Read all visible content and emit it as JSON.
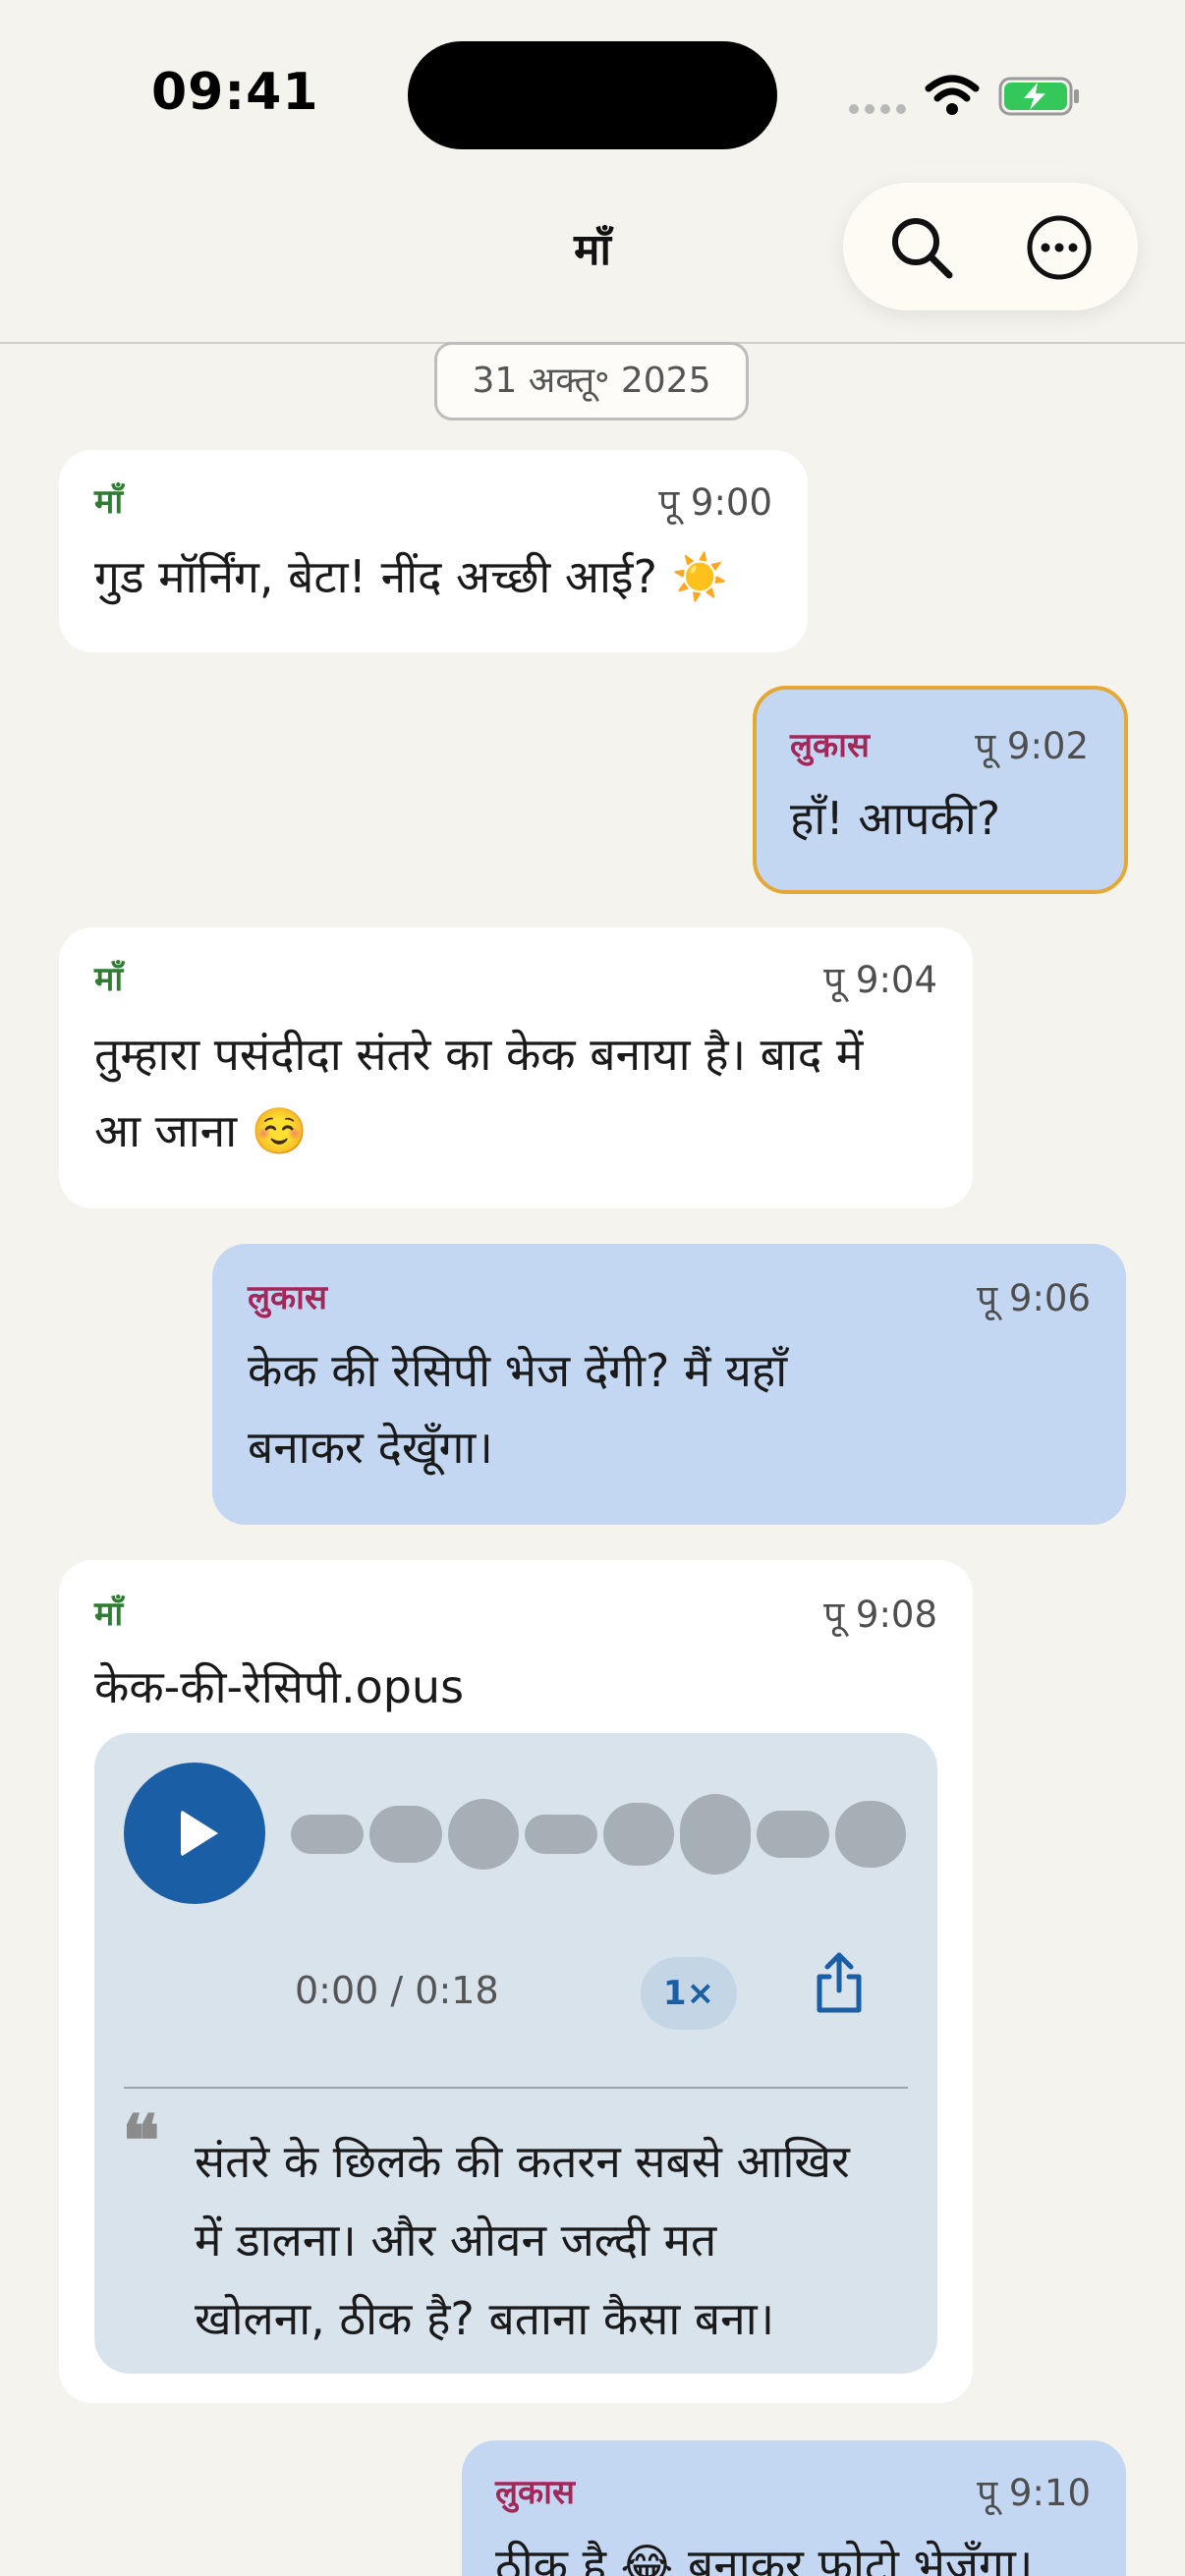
{
  "status_bar": {
    "time": "09:41",
    "icons": [
      "signal-dots-icon",
      "wifi-icon",
      "battery-charging-icon"
    ],
    "battery_color": "#34c759"
  },
  "header": {
    "title": "माँ",
    "actions": [
      "search-icon",
      "more-icon"
    ]
  },
  "date_chip": "31 अक्तू॰ 2025",
  "messages": [
    {
      "direction": "in",
      "sender": "माँ",
      "time": "पू 9:00",
      "text": "गुड मॉर्निंग, बेटा! नींद अच्छी आई? ☀️"
    },
    {
      "direction": "out",
      "sender": "लुकास",
      "time": "पू 9:02",
      "text": "हाँ! आपकी?",
      "highlighted": true
    },
    {
      "direction": "in",
      "sender": "माँ",
      "time": "पू 9:04",
      "line1": "तुम्हारा पसंदीदा संतरे का केक बनाया है। बाद में",
      "line2": "आ जाना ☺️"
    },
    {
      "direction": "out",
      "sender": "लुकास",
      "time": "पू 9:06",
      "line1": "केक की रेसिपी भेज देंगी? मैं यहाँ",
      "line2": "बनाकर देखूँगा।"
    },
    {
      "direction": "in",
      "sender": "माँ",
      "time": "पू 9:08",
      "filename": "केक-की-रेसिपी.opus",
      "voice": {
        "duration": "0:00 / 0:18",
        "speed": "1×",
        "progress": 0,
        "transcript_line1": "संतरे के छिलके की कतरन सबसे आखिर",
        "transcript_line2": "में डालना। और ओवन जल्दी मत",
        "transcript_line3": "खोलना, ठीक है? बताना कैसा बना।"
      }
    },
    {
      "direction": "out",
      "sender": "लुकास",
      "time": "पू 9:10",
      "text": "ठीक है 😂 बनाकर फोटो भेजूँगा।"
    }
  ],
  "colors": {
    "background": "#f5f3ed",
    "incoming_bubble": "#ffffff",
    "outgoing_bubble": "#c3d7f2",
    "highlight_border": "#e5a836",
    "mom_name": "#2e7d32",
    "lukas_name": "#a2285a",
    "play_button": "#1a5ea6"
  }
}
